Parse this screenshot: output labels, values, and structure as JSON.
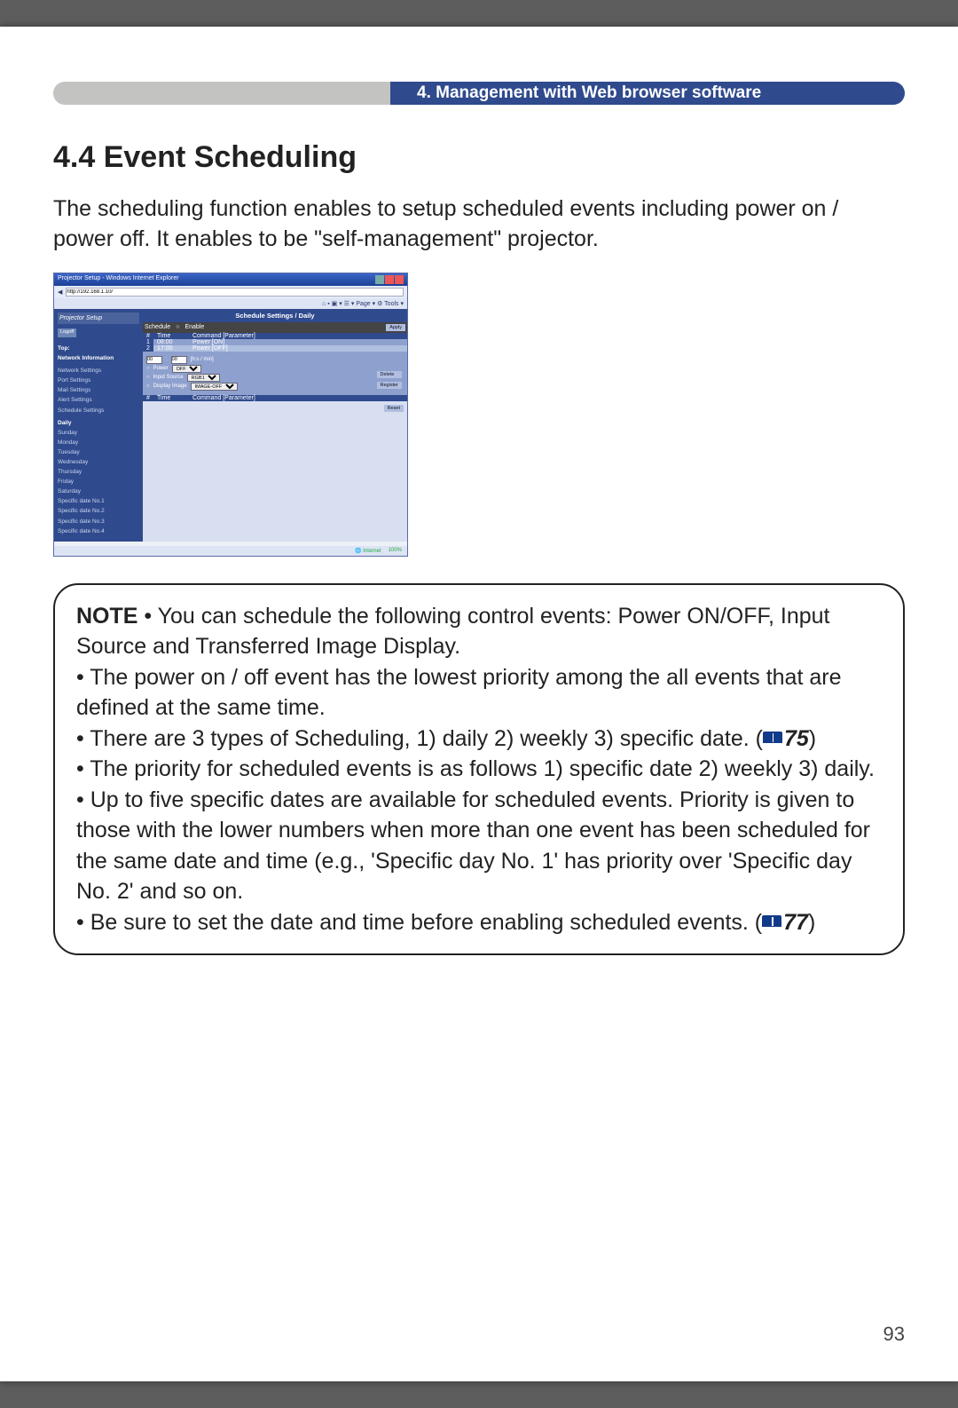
{
  "header": {
    "chapter": "4. Management with Web browser software"
  },
  "section": {
    "title": "4.4 Event Scheduling",
    "intro": "The scheduling function enables to setup scheduled events including power on / power off. It enables to be \"self-management\" projector."
  },
  "screenshot": {
    "window_title": "Projector Setup - Windows Internet Explorer",
    "address": "http://192.168.1.10/",
    "brand": "Projector Setup",
    "logoff": "Logoff",
    "sidebar_top": [
      "Top:",
      "Network Information"
    ],
    "sidebar_items": [
      "Network Settings",
      "Port Settings",
      "Mail Settings",
      "Alert Settings",
      "Schedule Settings"
    ],
    "sidebar_sched": [
      "Daily",
      "Sunday",
      "Monday",
      "Tuesday",
      "Wednesday",
      "Thursday",
      "Friday",
      "Saturday",
      "Specific date No.1",
      "Specific date No.2",
      "Specific date No.3",
      "Specific date No.4"
    ],
    "main_title": "Schedule Settings / Daily",
    "strip_label": "Schedule",
    "strip_enable": "Enable",
    "btn_apply": "Apply",
    "cols": [
      "#",
      "Time",
      "Command [Parameter]"
    ],
    "rows": [
      {
        "n": "1",
        "time": "08:00",
        "cmd": "Power [ON]"
      },
      {
        "n": "2",
        "time": "17:00",
        "cmd": "Power [OFF]"
      }
    ],
    "form": {
      "time_h": "00",
      "time_m": "00",
      "timefmt": "[h:s / min]",
      "l_power": "Power",
      "v_power": "OFF",
      "l_input": "Input Source",
      "v_input": "RGB1",
      "l_disp": "Display Image",
      "v_disp": "IMAGE-OFF"
    },
    "btn_delete": "Delete",
    "btn_register": "Register",
    "cols2": [
      "#",
      "Time",
      "Command [Parameter]"
    ],
    "btn_reset": "Reset",
    "status_left": "Internet",
    "status_right": "100%"
  },
  "note": {
    "lead": "NOTE",
    "l1a": " • You can schedule the following control events: Power ON/OFF, Input Source and Transferred Image Display.",
    "l2": "• The power on / off event has the lowest priority among the all events that are defined at the same time.",
    "l3a": "• There are 3 types of Scheduling, 1) daily 2) weekly 3) specific date. (",
    "l3ref": "75",
    "l3b": ")",
    "l4": "• The priority for scheduled events is as follows 1) specific date 2) weekly 3) daily.",
    "l5": "• Up to five specific dates are available for scheduled events. Priority is given to those with the lower numbers when more than one event has been scheduled for the same date and time (e.g., 'Specific day No. 1' has priority over 'Specific day No. 2' and so on.",
    "l6a": "• Be sure to set the date and time before enabling scheduled events. (",
    "l6ref": "77",
    "l6b": ")"
  },
  "page_number": "93"
}
